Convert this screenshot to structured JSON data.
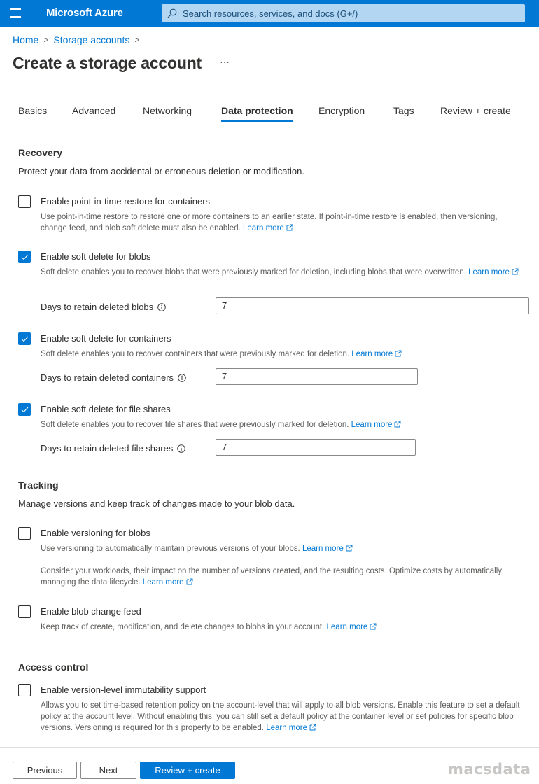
{
  "header": {
    "brand": "Microsoft Azure",
    "search_placeholder": "Search resources, services, and docs (G+/)"
  },
  "breadcrumb": [
    {
      "label": "Home"
    },
    {
      "label": "Storage accounts"
    }
  ],
  "page_title": "Create a storage account",
  "more_label": "···",
  "tabs": [
    {
      "label": "Basics",
      "active": false
    },
    {
      "label": "Advanced",
      "active": false
    },
    {
      "label": "Networking",
      "active": false
    },
    {
      "label": "Data protection",
      "active": true
    },
    {
      "label": "Encryption",
      "active": false
    },
    {
      "label": "Tags",
      "active": false
    },
    {
      "label": "Review + create",
      "active": false
    }
  ],
  "recovery": {
    "title": "Recovery",
    "description": "Protect your data from accidental or erroneous deletion or modification.",
    "point_in_time": {
      "label": "Enable point-in-time restore for containers",
      "checked": false,
      "description": "Use point-in-time restore to restore one or more containers to an earlier state. If point-in-time restore is enabled, then versioning, change feed, and blob soft delete must also be enabled.",
      "learn_more": "Learn more"
    },
    "soft_delete_blobs": {
      "label": "Enable soft delete for blobs",
      "checked": true,
      "description": "Soft delete enables you to recover blobs that were previously marked for deletion, including blobs that were overwritten.",
      "learn_more": "Learn more",
      "field_label": "Days to retain deleted blobs",
      "field_value": "7"
    },
    "soft_delete_containers": {
      "label": "Enable soft delete for containers",
      "checked": true,
      "description": "Soft delete enables you to recover containers that were previously marked for deletion.",
      "learn_more": "Learn more",
      "field_label": "Days to retain deleted containers",
      "field_value": "7"
    },
    "soft_delete_file_shares": {
      "label": "Enable soft delete for file shares",
      "checked": true,
      "description": "Soft delete enables you to recover file shares that were previously marked for deletion.",
      "learn_more": "Learn more",
      "field_label": "Days to retain deleted file shares",
      "field_value": "7"
    }
  },
  "tracking": {
    "title": "Tracking",
    "description": "Manage versions and keep track of changes made to your blob data.",
    "versioning": {
      "label": "Enable versioning for blobs",
      "checked": false,
      "description": "Use versioning to automatically maintain previous versions of your blobs.",
      "learn_more": "Learn more",
      "note": "Consider your workloads, their impact on the number of versions created, and the resulting costs. Optimize costs by automatically managing the data lifecycle.",
      "note_learn_more": "Learn more"
    },
    "change_feed": {
      "label": "Enable blob change feed",
      "checked": false,
      "description": "Keep track of create, modification, and delete changes to blobs in your account.",
      "learn_more": "Learn more"
    }
  },
  "access_control": {
    "title": "Access control",
    "immutability": {
      "label": "Enable version-level immutability support",
      "checked": false,
      "description": "Allows you to set time-based retention policy on the account-level that will apply to all blob versions. Enable this feature to set a default policy at the account level. Without enabling this, you can still set a default policy at the container level or set policies for specific blob versions. Versioning is required for this property to be enabled.",
      "learn_more": "Learn more"
    }
  },
  "footer": {
    "previous": "Previous",
    "next": "Next",
    "review_create": "Review + create"
  },
  "watermark": "macsdata",
  "colors": {
    "accent": "#0078d4",
    "search_bg": "#b3d6f2"
  }
}
